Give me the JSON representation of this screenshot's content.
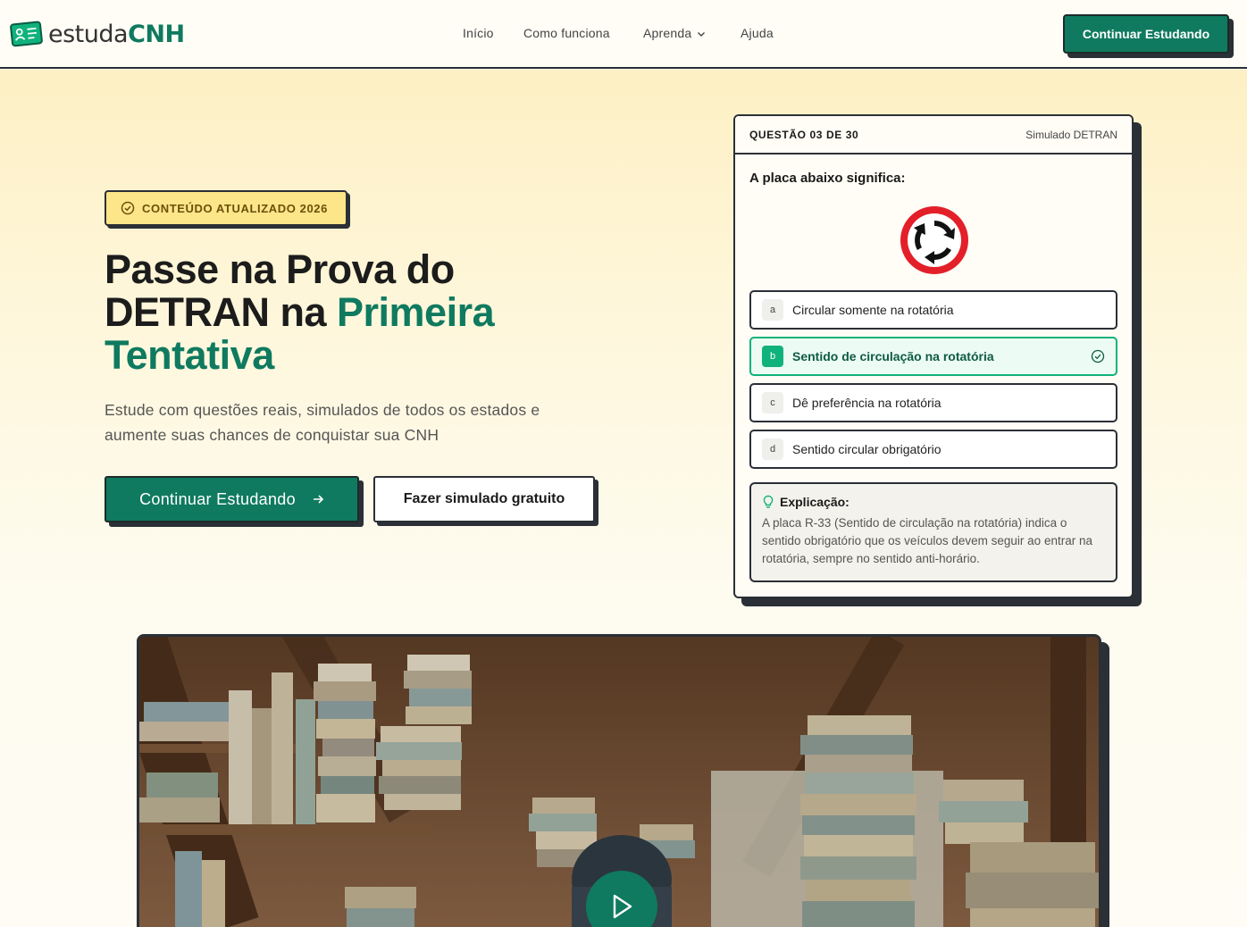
{
  "header": {
    "logo": {
      "prefix": "estuda",
      "brand": "CNH",
      "icon": "id-card-icon"
    },
    "nav": [
      {
        "label": "Início"
      },
      {
        "label": "Como funciona"
      },
      {
        "label": "Aprenda",
        "icon": "chevron-down-icon"
      },
      {
        "label": "Ajuda"
      }
    ],
    "cta_label": "Continuar Estudando"
  },
  "hero": {
    "badge": {
      "label": "CONTEÚDO ATUALIZADO 2026",
      "icon": "check-circle-icon"
    },
    "headline": {
      "line1": "Passe na Prova do",
      "line2_plain": "DETRAN na ",
      "line2_accent": "Primeira",
      "line3_accent": "Tentativa"
    },
    "subtext": "Estude com questões reais, simulados de todos os estados e aumente suas chances de conquistar sua CNH",
    "primary_button": {
      "label": "Continuar Estudando",
      "icon": "arrow-right-icon"
    },
    "secondary_button": {
      "label": "Fazer simulado gratuito"
    }
  },
  "quiz": {
    "counter": "QUESTÃO 03 DE 30",
    "mode": "Simulado DETRAN",
    "question": "A placa abaixo significa:",
    "sign_icon": "roundabout-sign-icon",
    "options": [
      {
        "letter": "a",
        "text": "Circular somente na rotatória",
        "correct": false
      },
      {
        "letter": "b",
        "text": "Sentido de circulação na rotatória",
        "correct": true
      },
      {
        "letter": "c",
        "text": "Dê preferência na rotatória",
        "correct": false
      },
      {
        "letter": "d",
        "text": "Sentido circular obrigatório",
        "correct": false
      }
    ],
    "explanation": {
      "title": "Explicação:",
      "icon": "lightbulb-icon",
      "text": "A placa R-33 (Sentido de circulação na rotatória) indica o sentido obrigatório que os veículos devem seguir ao entrar na rotatória, sempre no sentido anti-horário."
    }
  },
  "video": {
    "icon": "play-icon"
  },
  "colors": {
    "accent": "#0f7a5f",
    "correct": "#10b27b",
    "badge": "#fde68a",
    "outline": "#2b2f36"
  }
}
